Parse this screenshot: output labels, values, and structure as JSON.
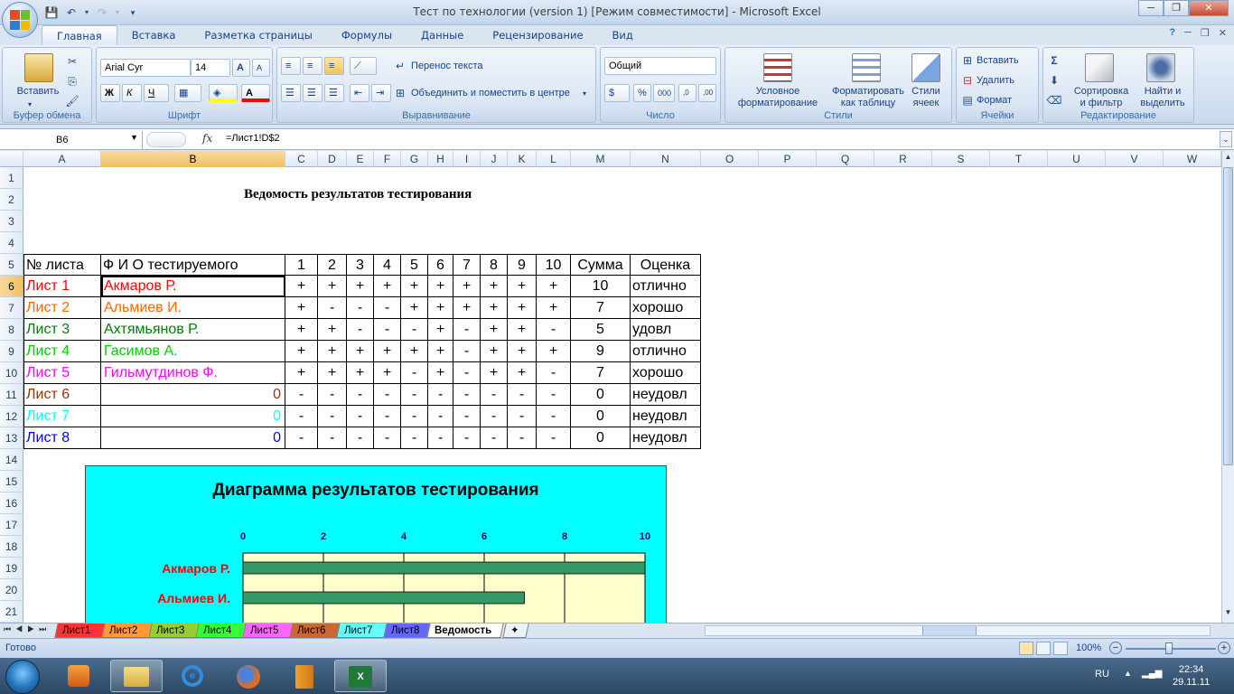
{
  "window": {
    "title": "Тест по технологии (version 1)  [Режим совместимости] - Microsoft Excel"
  },
  "ribbon_tabs": [
    "Главная",
    "Вставка",
    "Разметка страницы",
    "Формулы",
    "Данные",
    "Рецензирование",
    "Вид"
  ],
  "ribbon": {
    "clipboard": {
      "paste": "Вставить",
      "label": "Буфер обмена"
    },
    "font": {
      "name": "Arial Cyr",
      "size": "14",
      "bold": "Ж",
      "italic": "К",
      "underline": "Ч",
      "label": "Шрифт"
    },
    "alignment": {
      "wrap": "Перенос текста",
      "merge": "Объединить и поместить в центре",
      "label": "Выравнивание"
    },
    "number": {
      "format": "Общий",
      "label": "Число"
    },
    "styles": {
      "conditional": "Условное",
      "conditional2": "форматирование",
      "as_table": "Форматировать",
      "as_table2": "как таблицу",
      "cell_styles": "Стили",
      "cell_styles2": "ячеек",
      "label": "Стили"
    },
    "cells": {
      "insert": "Вставить",
      "delete": "Удалить",
      "format": "Формат",
      "label": "Ячейки"
    },
    "editing": {
      "sort": "Сортировка",
      "sort2": "и фильтр",
      "find": "Найти и",
      "find2": "выделить",
      "label": "Редактирование"
    }
  },
  "formula_bar": {
    "name_box": "B6",
    "formula": "=Лист1!D$2"
  },
  "columns": [
    "A",
    "B",
    "C",
    "D",
    "E",
    "F",
    "G",
    "H",
    "I",
    "J",
    "K",
    "L",
    "M",
    "N",
    "O",
    "P",
    "Q",
    "R",
    "S",
    "T",
    "U",
    "V",
    "W"
  ],
  "rows": [
    "1",
    "2",
    "3",
    "4",
    "5",
    "6",
    "7",
    "8",
    "9",
    "10",
    "11",
    "12",
    "13",
    "14",
    "15",
    "16",
    "17",
    "18",
    "19",
    "20",
    "21"
  ],
  "sheet": {
    "title": "Ведомость результатов тестирования",
    "headers": [
      "№ листа",
      "Ф И О тестируемого",
      "1",
      "2",
      "3",
      "4",
      "5",
      "6",
      "7",
      "8",
      "9",
      "10",
      "Сумма",
      "Оценка"
    ],
    "data": [
      {
        "sheet": "Лист 1",
        "name": "Акмаров Р.",
        "answers": [
          "+",
          "+",
          "+",
          "+",
          "+",
          "+",
          "+",
          "+",
          "+",
          "+"
        ],
        "sum": "10",
        "grade": "отлично",
        "color": "#ff0000"
      },
      {
        "sheet": "Лист 2",
        "name": "Альмиев И.",
        "answers": [
          "+",
          "-",
          "-",
          "-",
          "+",
          "+",
          "+",
          "+",
          "+",
          "+"
        ],
        "sum": "7",
        "grade": "хорошо",
        "color": "#ff6600"
      },
      {
        "sheet": "Лист 3",
        "name": "Ахтямьянов Р.",
        "answers": [
          "+",
          "+",
          "-",
          "-",
          "-",
          "+",
          "-",
          "+",
          "+",
          "-"
        ],
        "sum": "5",
        "grade": "удовл",
        "color": "#008000"
      },
      {
        "sheet": "Лист 4",
        "name": "Гасимов А.",
        "answers": [
          "+",
          "+",
          "+",
          "+",
          "+",
          "+",
          "-",
          "+",
          "+",
          "+"
        ],
        "sum": "9",
        "grade": "отлично",
        "color": "#00cc00"
      },
      {
        "sheet": "Лист 5",
        "name": "Гильмутдинов Ф.",
        "answers": [
          "+",
          "+",
          "+",
          "+",
          "-",
          "+",
          "-",
          "+",
          "+",
          "-"
        ],
        "sum": "7",
        "grade": "хорошо",
        "color": "#ff00ff"
      },
      {
        "sheet": "Лист 6",
        "name": "0",
        "answers": [
          "-",
          "-",
          "-",
          "-",
          "-",
          "-",
          "-",
          "-",
          "-",
          "-"
        ],
        "sum": "0",
        "grade": "неудовл",
        "color": "#993300"
      },
      {
        "sheet": "Лист 7",
        "name": "0",
        "answers": [
          "-",
          "-",
          "-",
          "-",
          "-",
          "-",
          "-",
          "-",
          "-",
          "-"
        ],
        "sum": "0",
        "grade": "неудовл",
        "color": "#00ffff"
      },
      {
        "sheet": "Лист 8",
        "name": "0",
        "answers": [
          "-",
          "-",
          "-",
          "-",
          "-",
          "-",
          "-",
          "-",
          "-",
          "-"
        ],
        "sum": "0",
        "grade": "неудовл",
        "color": "#0000ff"
      }
    ]
  },
  "chart_data": {
    "type": "bar",
    "title": "Диаграмма результатов  тестирования",
    "categories": [
      "Акмаров Р.",
      "Альмиев И."
    ],
    "values": [
      10,
      7
    ],
    "xlim": [
      0,
      10
    ],
    "x_ticks": [
      "0",
      "2",
      "4",
      "6",
      "8",
      "10"
    ],
    "bar_color": "#339966",
    "plot_bg": "#ffffcc",
    "chart_bg": "#00ffff"
  },
  "sheet_tabs": [
    {
      "label": "Лист1",
      "color": "#ff3333"
    },
    {
      "label": "Лист2",
      "color": "#ff9933"
    },
    {
      "label": "Лист3",
      "color": "#99cc33"
    },
    {
      "label": "Лист4",
      "color": "#33ff33"
    },
    {
      "label": "Лист5",
      "color": "#ff66ff"
    },
    {
      "label": "Лист6",
      "color": "#cc6633"
    },
    {
      "label": "Лист7",
      "color": "#66ffff"
    },
    {
      "label": "Лист8",
      "color": "#6666ff"
    },
    {
      "label": "Ведомость",
      "color": "#ffffff"
    }
  ],
  "status": {
    "ready": "Готово",
    "zoom": "100%"
  },
  "taskbar": {
    "lang": "RU",
    "time": "22:34",
    "date": "29.11.11"
  }
}
